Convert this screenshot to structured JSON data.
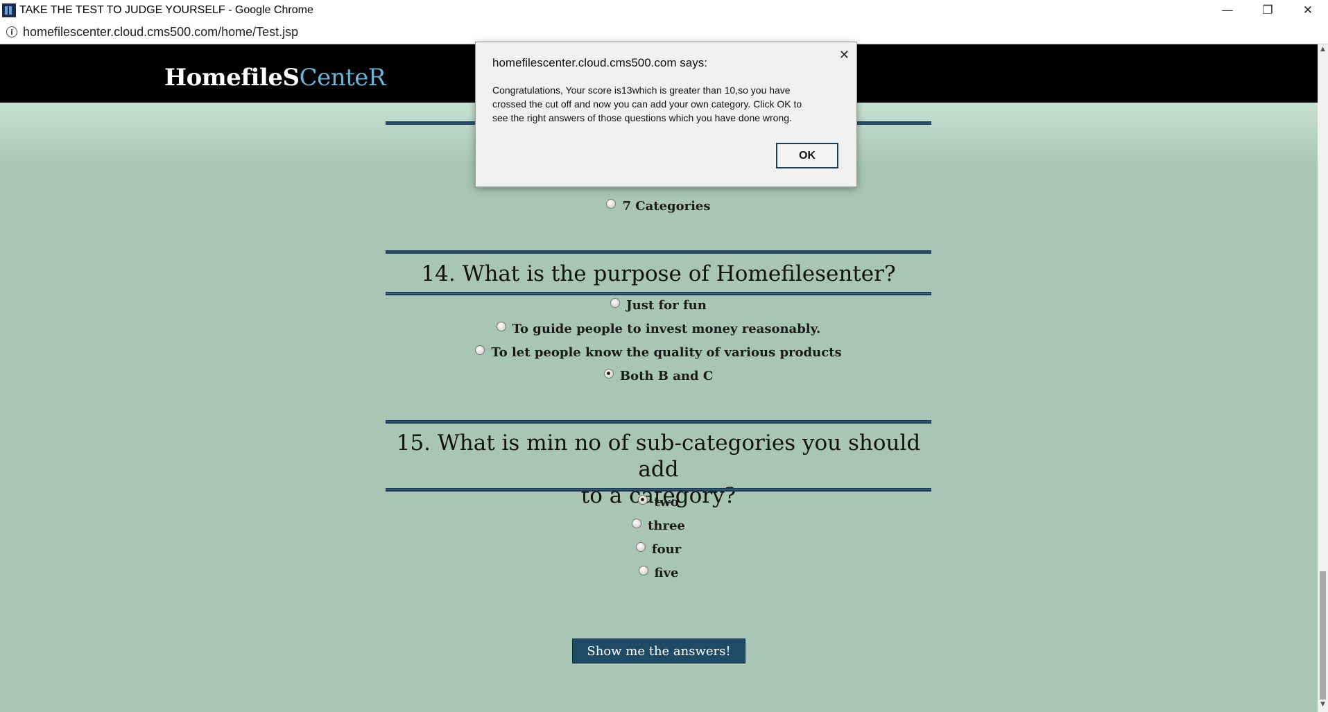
{
  "window": {
    "title": "TAKE THE TEST TO JUDGE YOURSELF - Google Chrome",
    "minimize_glyph": "—",
    "restore_glyph": "❐",
    "close_glyph": "✕"
  },
  "address_bar": {
    "url": "homefilescenter.cloud.cms500.com/home/Test.jsp",
    "info_glyph": "i"
  },
  "site": {
    "logo_main": "HomefileS",
    "logo_accent": "CenteR"
  },
  "partial_question": {
    "visible_option": "7 Categories"
  },
  "questions": [
    {
      "title": "14. What is the purpose of Homefilesenter?",
      "options": [
        "Just for fun",
        "To guide people to invest money reasonably.",
        "To let people know the quality of various products",
        "Both B and C"
      ],
      "selected": "Both B and C"
    },
    {
      "title_line1": "15. What is min no of sub-categories you should add",
      "title_line2": "to a category?",
      "options": [
        "two",
        "three",
        "four",
        "five"
      ],
      "selected": "two"
    }
  ],
  "answers_button": "Show me the answers!",
  "dialog": {
    "title": "homefilescenter.cloud.cms500.com says:",
    "message_line1": "Congratulations, Your score is13which is greater than 10,so you have",
    "message_line2": "crossed the cut off and now you can add your own category. Click OK to",
    "message_line3": "see the right answers of those questions which you have done wrong.",
    "ok_label": "OK",
    "close_glyph": "✕"
  },
  "scrollbar": {
    "up_glyph": "▲",
    "down_glyph": "▼"
  },
  "colors": {
    "page_background": "#a8c5b5",
    "header_background": "#000000",
    "logo_accent": "#6ab4d8",
    "button_background": "#1f4b66"
  }
}
